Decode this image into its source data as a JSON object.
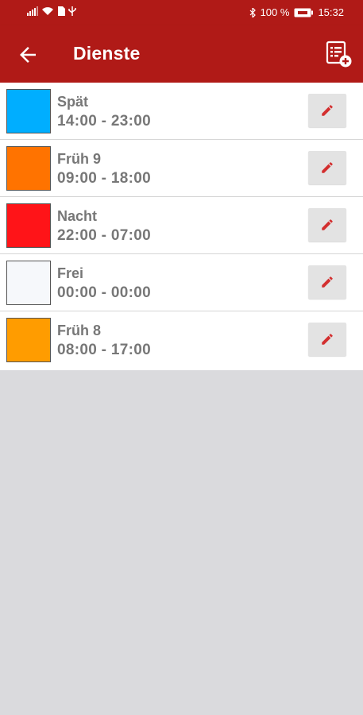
{
  "statusbar": {
    "battery": "100 %",
    "time": "15:32"
  },
  "toolbar": {
    "title": "Dienste",
    "back_icon": "arrow-left-icon",
    "add_icon": "list-add-icon"
  },
  "shifts": [
    {
      "name": "Spät",
      "time": "14:00 - 23:00",
      "color": "#00aeff"
    },
    {
      "name": "Früh 9",
      "time": "09:00 - 18:00",
      "color": "#ff7300"
    },
    {
      "name": "Nacht",
      "time": "22:00 - 07:00",
      "color": "#ff1418"
    },
    {
      "name": "Frei",
      "time": "00:00 - 00:00",
      "color": "#f6f8fb"
    },
    {
      "name": "Früh 8",
      "time": "08:00 - 17:00",
      "color": "#ff9c00"
    }
  ],
  "colors": {
    "brand": "#b01a17",
    "edit_icon": "#d32f2f",
    "background": "#dadadd"
  }
}
